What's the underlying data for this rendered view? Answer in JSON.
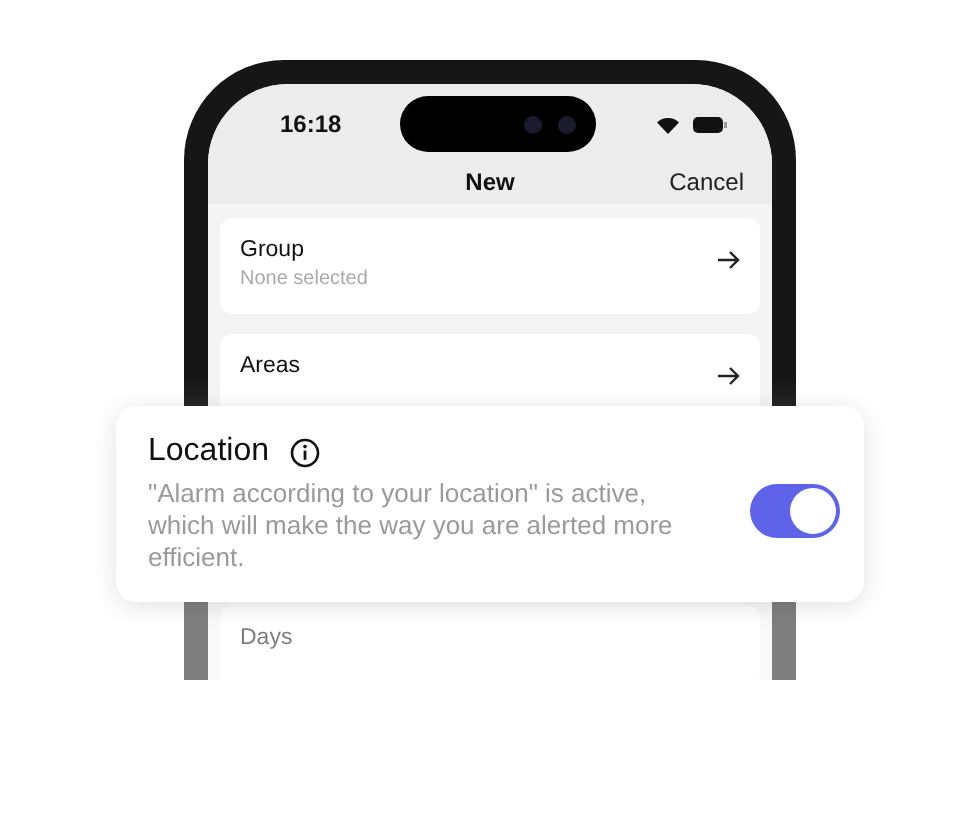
{
  "status_bar": {
    "time": "16:18"
  },
  "nav": {
    "title": "New",
    "action": "Cancel"
  },
  "rows": [
    {
      "title": "Group",
      "subtitle": "None selected"
    },
    {
      "title": "Areas"
    },
    {
      "title": "Days"
    }
  ],
  "card": {
    "title": "Location",
    "description": "\"Alarm according to your location\" is active, which will make the way you are alerted more efficient.",
    "on": true
  }
}
